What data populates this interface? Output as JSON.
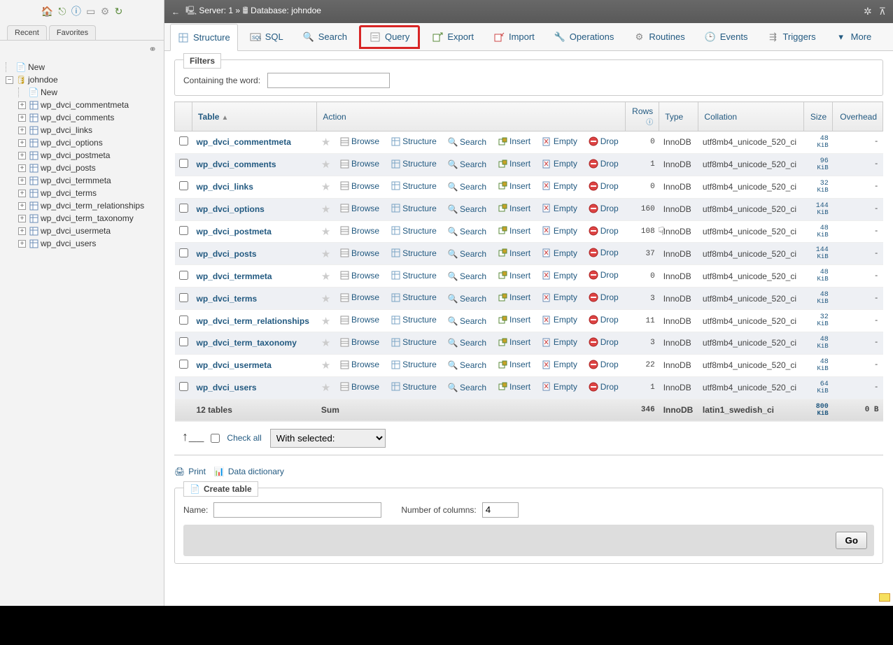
{
  "sidebar": {
    "tabs": {
      "recent": "Recent",
      "favorites": "Favorites"
    },
    "new": "New",
    "database": "johndoe",
    "db_new": "New",
    "tables": [
      "wp_dvci_commentmeta",
      "wp_dvci_comments",
      "wp_dvci_links",
      "wp_dvci_options",
      "wp_dvci_postmeta",
      "wp_dvci_posts",
      "wp_dvci_termmeta",
      "wp_dvci_terms",
      "wp_dvci_term_relationships",
      "wp_dvci_term_taxonomy",
      "wp_dvci_usermeta",
      "wp_dvci_users"
    ]
  },
  "breadcrumb": {
    "server_label": "Server: ",
    "server": "1",
    "sep": " » ",
    "db_label": "Database: ",
    "db": "johndoe"
  },
  "tabs": {
    "structure": "Structure",
    "sql": "SQL",
    "search": "Search",
    "query": "Query",
    "export": "Export",
    "import": "Import",
    "operations": "Operations",
    "routines": "Routines",
    "events": "Events",
    "triggers": "Triggers",
    "more": "More"
  },
  "filters": {
    "legend": "Filters",
    "label": "Containing the word:",
    "value": ""
  },
  "columns": {
    "table": "Table",
    "action": "Action",
    "rows": "Rows",
    "type": "Type",
    "collation": "Collation",
    "size": "Size",
    "overhead": "Overhead"
  },
  "actions": {
    "browse": "Browse",
    "structure": "Structure",
    "search": "Search",
    "insert": "Insert",
    "empty": "Empty",
    "drop": "Drop"
  },
  "rows": [
    {
      "name": "wp_dvci_commentmeta",
      "rows": "0",
      "type": "InnoDB",
      "collation": "utf8mb4_unicode_520_ci",
      "size_v": "48",
      "size_u": "KiB",
      "overhead": "-"
    },
    {
      "name": "wp_dvci_comments",
      "rows": "1",
      "type": "InnoDB",
      "collation": "utf8mb4_unicode_520_ci",
      "size_v": "96",
      "size_u": "KiB",
      "overhead": "-"
    },
    {
      "name": "wp_dvci_links",
      "rows": "0",
      "type": "InnoDB",
      "collation": "utf8mb4_unicode_520_ci",
      "size_v": "32",
      "size_u": "KiB",
      "overhead": "-"
    },
    {
      "name": "wp_dvci_options",
      "rows": "160",
      "type": "InnoDB",
      "collation": "utf8mb4_unicode_520_ci",
      "size_v": "144",
      "size_u": "KiB",
      "overhead": "-"
    },
    {
      "name": "wp_dvci_postmeta",
      "rows": "108",
      "type": "InnoDB",
      "collation": "utf8mb4_unicode_520_ci",
      "size_v": "48",
      "size_u": "KiB",
      "overhead": "-"
    },
    {
      "name": "wp_dvci_posts",
      "rows": "37",
      "type": "InnoDB",
      "collation": "utf8mb4_unicode_520_ci",
      "size_v": "144",
      "size_u": "KiB",
      "overhead": "-"
    },
    {
      "name": "wp_dvci_termmeta",
      "rows": "0",
      "type": "InnoDB",
      "collation": "utf8mb4_unicode_520_ci",
      "size_v": "48",
      "size_u": "KiB",
      "overhead": "-"
    },
    {
      "name": "wp_dvci_terms",
      "rows": "3",
      "type": "InnoDB",
      "collation": "utf8mb4_unicode_520_ci",
      "size_v": "48",
      "size_u": "KiB",
      "overhead": "-"
    },
    {
      "name": "wp_dvci_term_relationships",
      "rows": "11",
      "type": "InnoDB",
      "collation": "utf8mb4_unicode_520_ci",
      "size_v": "32",
      "size_u": "KiB",
      "overhead": "-"
    },
    {
      "name": "wp_dvci_term_taxonomy",
      "rows": "3",
      "type": "InnoDB",
      "collation": "utf8mb4_unicode_520_ci",
      "size_v": "48",
      "size_u": "KiB",
      "overhead": "-"
    },
    {
      "name": "wp_dvci_usermeta",
      "rows": "22",
      "type": "InnoDB",
      "collation": "utf8mb4_unicode_520_ci",
      "size_v": "48",
      "size_u": "KiB",
      "overhead": "-"
    },
    {
      "name": "wp_dvci_users",
      "rows": "1",
      "type": "InnoDB",
      "collation": "utf8mb4_unicode_520_ci",
      "size_v": "64",
      "size_u": "KiB",
      "overhead": "-"
    }
  ],
  "totals": {
    "label": "12 tables",
    "sum": "Sum",
    "rows": "346",
    "type": "InnoDB",
    "collation": "latin1_swedish_ci",
    "size_v": "800",
    "size_u": "KiB",
    "overhead": "0 B"
  },
  "checkall": {
    "label": "Check all",
    "select": "With selected:"
  },
  "print": "Print",
  "data_dictionary": "Data dictionary",
  "create": {
    "legend": "Create table",
    "name_label": "Name:",
    "name_val": "",
    "cols_label": "Number of columns:",
    "cols_val": "4",
    "go": "Go"
  }
}
